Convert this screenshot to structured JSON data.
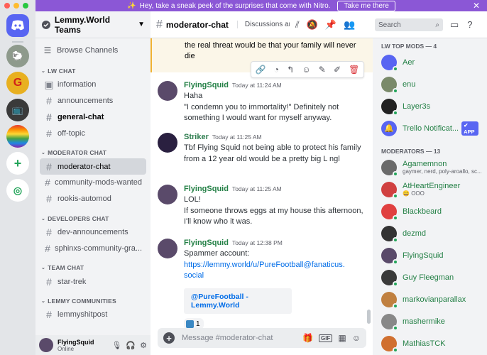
{
  "banner": {
    "text": "Hey, take a sneak peek of the surprises that come with Nitro.",
    "button": "Take me there",
    "close": "✕"
  },
  "colors": {
    "nitro_purple": "#8b57d6",
    "online_green": "#23a55a",
    "name_green": "#248046",
    "link_blue": "#006ce7"
  },
  "sidebar": {
    "guild_name": "Lemmy.World Teams",
    "browse_label": "Browse Channels",
    "categories": [
      {
        "name": "LW CHAT",
        "channels": [
          "information",
          "announcements",
          "general-chat",
          "off-topic"
        ]
      },
      {
        "name": "MODERATOR CHAT",
        "channels": [
          "moderator-chat",
          "community-mods-wanted",
          "rookis-automod"
        ]
      },
      {
        "name": "DEVELOPERS CHAT",
        "channels": [
          "dev-announcements",
          "sphinxs-community-gra..."
        ]
      },
      {
        "name": "TEAM CHAT",
        "channels": [
          "star-trek"
        ]
      },
      {
        "name": "LEMMY COMMUNITIES",
        "channels": [
          "lemmyshitpost"
        ]
      }
    ],
    "user": {
      "name": "FlyingSquid",
      "status": "Online"
    }
  },
  "channel": {
    "name": "moderator-chat",
    "topic": "Discussions amo...",
    "search_placeholder": "Search",
    "composer_placeholder": "Message #moderator-chat"
  },
  "messages": {
    "highlight_text": "the real threat would be that your family will never die",
    "m1": {
      "author": "FlyingSquid",
      "time": "Today at 11:24 AM",
      "lines": [
        "Haha",
        "\"I condemn you to immortality!\" Definitely not something I would want for myself anyway."
      ]
    },
    "m2": {
      "author": "Striker",
      "time": "Today at 11:25 AM",
      "text": "Tbf Flying Squid not being able to protect his family from a 12 year old would be a pretty big L ngl"
    },
    "m3": {
      "author": "FlyingSquid",
      "time": "Today at 11:25 AM",
      "lines": [
        "LOL!",
        "If someone throws eggs at my house this afternoon, I'll know who it was."
      ]
    },
    "m4": {
      "author": "FlyingSquid",
      "time": "Today at 12:38 PM",
      "text": "Spammer account:",
      "link": "https://lemmy.world/u/PureFootball@fanaticus.social",
      "embed_title": "@PureFootball - Lemmy.World",
      "reaction_count": "1"
    }
  },
  "members": {
    "groups": [
      {
        "title": "LW TOP MODS — 4",
        "items": [
          {
            "name": "Aer",
            "sub": ""
          },
          {
            "name": "enu",
            "sub": ""
          },
          {
            "name": "Layer3s",
            "sub": ""
          },
          {
            "name": "Trello Notificat...",
            "sub": "",
            "badge": "✔ APP"
          }
        ]
      },
      {
        "title": "MODERATORS — 13",
        "items": [
          {
            "name": "Agamemnon",
            "sub": "gaymer, nerd, poly-aroallo, sc..."
          },
          {
            "name": "AtHeartEngineer",
            "sub": "OOO"
          },
          {
            "name": "Blackbeard",
            "sub": ""
          },
          {
            "name": "dezmd",
            "sub": ""
          },
          {
            "name": "FlyingSquid",
            "sub": ""
          },
          {
            "name": "Guy Fleegman",
            "sub": ""
          },
          {
            "name": "markovianparallax",
            "sub": ""
          },
          {
            "name": "mashermike",
            "sub": ""
          },
          {
            "name": "MathiasTCK",
            "sub": ""
          }
        ]
      }
    ]
  }
}
